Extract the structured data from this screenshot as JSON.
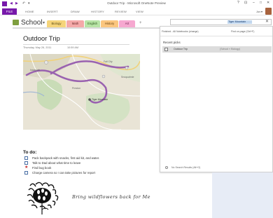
{
  "window": {
    "title": "Outdoor Trip - Microsoft OneNote Preview",
    "controls": {
      "help": "?",
      "ribbon_display": "⊡",
      "minimize": "–",
      "maximize": "□",
      "close": "✕"
    }
  },
  "quick_access": {
    "back": "◀",
    "forward": "▶",
    "undo": "↶",
    "customize": "▾"
  },
  "ribbon": {
    "file_tab": "FILE",
    "tabs": [
      "HOME",
      "INSERT",
      "DRAW",
      "HISTORY",
      "REVIEW",
      "VIEW"
    ],
    "user_name": "Jon",
    "user_chevron": "▾"
  },
  "notebook": {
    "name": "School",
    "chevron": "▾",
    "icon_color": "#7f9f3f",
    "sections": [
      {
        "label": "Biology",
        "color": "#f5d47a",
        "text": "#5a4a14"
      },
      {
        "label": "Math",
        "color": "#f4a9a9",
        "text": "#6a2828"
      },
      {
        "label": "English",
        "color": "#b8e4a6",
        "text": "#2f5a20"
      },
      {
        "label": "History",
        "color": "#fbc67f",
        "text": "#6a4210"
      },
      {
        "label": "Art",
        "color": "#f6a8d0",
        "text": "#6a1f48"
      }
    ],
    "add_section": "+"
  },
  "search": {
    "query": "Tiger Mountain",
    "close_icon": "✕",
    "scope": "Finished - All Notebooks (change)",
    "find_on_page": "Find on page (Ctrl+F)",
    "recent_picks_label": "Recent picks",
    "results": [
      {
        "title": "Outdoor Trip",
        "location": "(School » Biology)"
      }
    ],
    "footer": "No Search Results (Alt+O)"
  },
  "page": {
    "title": "Outdoor Trip",
    "date": "Thursday, May 26, 2011",
    "time": "10:59 AM",
    "map_labels": [
      "Fall City",
      "Snoqualmie",
      "Issaquah",
      "Tiger Mountain",
      "Preston"
    ],
    "todo_heading": "To do:",
    "todo_items": [
      {
        "text": "Pack backpack with snacks, first aid kit, and water.",
        "tag": "checkbox"
      },
      {
        "text": "Talk to Dad about what time to leave",
        "tag": "checkbox"
      },
      {
        "text": "Find bug book",
        "tag": "star"
      },
      {
        "text": "Charge camera so I can take pictures for report",
        "tag": "checkbox"
      }
    ],
    "handwriting": "Bring wildflowers back for Me"
  },
  "colors": {
    "accent": "#7719aa",
    "pagelist_bg": "#e7ecf6",
    "map_route": "#9a62b0",
    "checkbox": "#4a6fa5",
    "star": "#c53030"
  }
}
